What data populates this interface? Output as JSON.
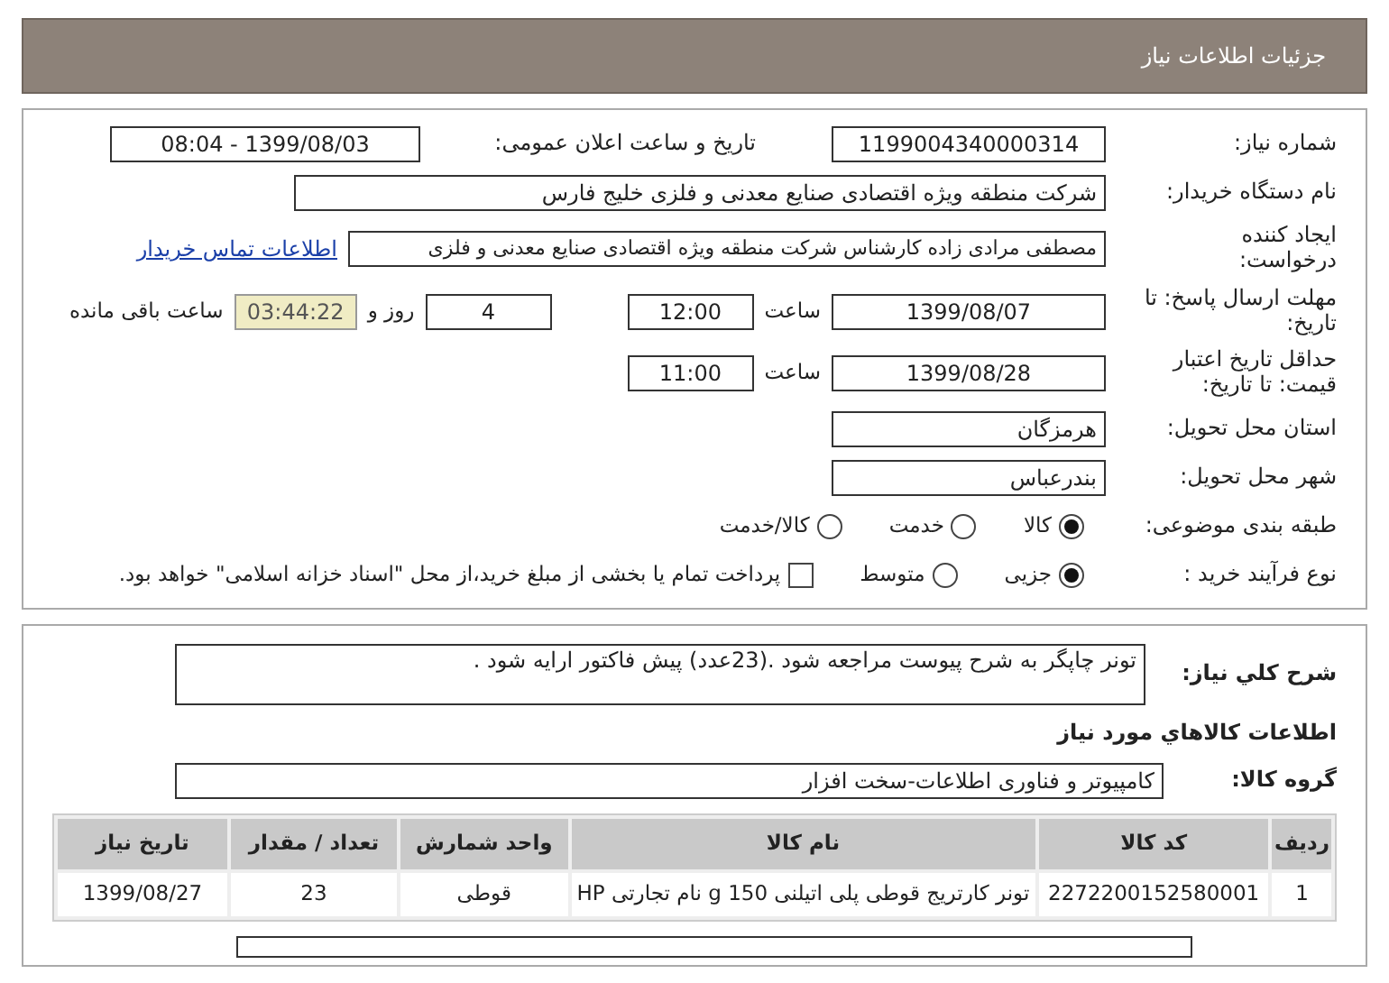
{
  "header": {
    "title": "جزئیات اطلاعات نیاز"
  },
  "details": {
    "need_number": {
      "label": "شماره نیاز:",
      "value": "1199004340000314"
    },
    "announce": {
      "label": "تاریخ و ساعت اعلان عمومی:",
      "value": "1399/08/03 - 08:04"
    },
    "buyer": {
      "label": "نام دستگاه خریدار:",
      "value": "شرکت منطقه ویژه اقتصادی صنایع معدنی و فلزی خلیج فارس"
    },
    "requester": {
      "label": "ایجاد کننده درخواست:",
      "value": "مصطفی مرادی زاده کارشناس شرکت منطقه ویژه اقتصادی صنایع معدنی و فلزی",
      "link": "اطلاعات تماس خریدار"
    },
    "deadline": {
      "label": "مهلت ارسال پاسخ: تا تاریخ:",
      "date": "1399/08/07",
      "time_label": "ساعت",
      "time": "12:00",
      "days": "4",
      "days_label": "روز و",
      "remaining": "03:44:22",
      "remaining_label": "ساعت باقی مانده"
    },
    "validity": {
      "label": "حداقل تاریخ اعتبار قیمت: تا تاریخ:",
      "date": "1399/08/28",
      "time_label": "ساعت",
      "time": "11:00"
    },
    "province": {
      "label": "استان محل تحویل:",
      "value": "هرمزگان"
    },
    "city": {
      "label": "شهر محل تحویل:",
      "value": "بندرعباس"
    },
    "category": {
      "label": "طبقه بندی موضوعی:",
      "options": [
        {
          "label": "کالا",
          "selected": true
        },
        {
          "label": "خدمت",
          "selected": false
        },
        {
          "label": "کالا/خدمت",
          "selected": false
        }
      ]
    },
    "process": {
      "label": "نوع فرآیند خرید :",
      "options": [
        {
          "label": "جزیی",
          "selected": true
        },
        {
          "label": "متوسط",
          "selected": false
        }
      ],
      "checkbox": {
        "label": "پرداخت تمام یا بخشی از مبلغ خرید،از محل \"اسناد خزانه اسلامی\" خواهد بود.",
        "checked": false
      }
    }
  },
  "description": {
    "label": "شرح کلي نياز:",
    "value": "تونر چاپگر به شرح پیوست مراجعه شود .(23عدد) پیش فاکتور  ارایه شود ."
  },
  "goods_title": "اطلاعات کالاهاي مورد نياز",
  "goods_group": {
    "label": "گروه کالا:",
    "value": "کامپیوتر و فناوری اطلاعات-سخت افزار"
  },
  "table": {
    "columns": [
      "ردیف",
      "کد کالا",
      "نام کالا",
      "واحد شمارش",
      "تعداد / مقدار",
      "تاریخ نیاز"
    ],
    "rows": [
      [
        "1",
        "2272200152580001",
        "تونر کارتریج قوطی پلی اتیلنی 150 g نام تجارتی HP",
        "قوطی",
        "23",
        "1399/08/27"
      ]
    ]
  }
}
